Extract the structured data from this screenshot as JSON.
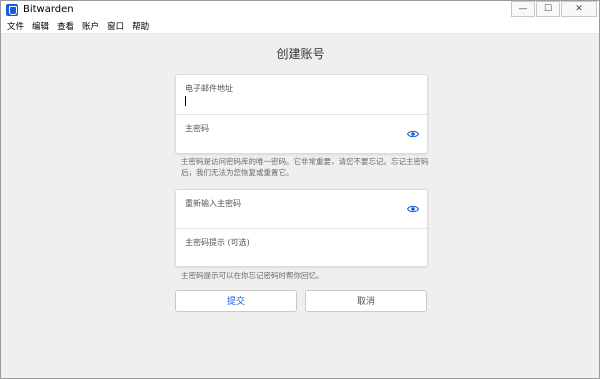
{
  "window": {
    "title": "Bitwarden",
    "controls": {
      "minimize": "—",
      "maximize": "☐",
      "close": "✕"
    }
  },
  "menu": [
    "文件",
    "编辑",
    "查看",
    "账户",
    "窗口",
    "帮助"
  ],
  "page": {
    "title": "创建账号"
  },
  "form1": {
    "email_label": "电子邮件地址",
    "email_value": "",
    "password_label": "主密码",
    "password_value": "",
    "password_hint": "主密码是访问密码库的唯一密码。它非常重要，请您不要忘记。忘记主密码后，我们无法为您恢复或重置它。"
  },
  "form2": {
    "retype_label": "重新输入主密码",
    "retype_value": "",
    "hint_label": "主密码提示 (可选)",
    "hint_value": "",
    "hint_help": "主密码提示可以在你忘记密码时帮你回忆。"
  },
  "buttons": {
    "submit": "提交",
    "cancel": "取消"
  },
  "colors": {
    "accent": "#175ddc",
    "background": "#efefef"
  }
}
